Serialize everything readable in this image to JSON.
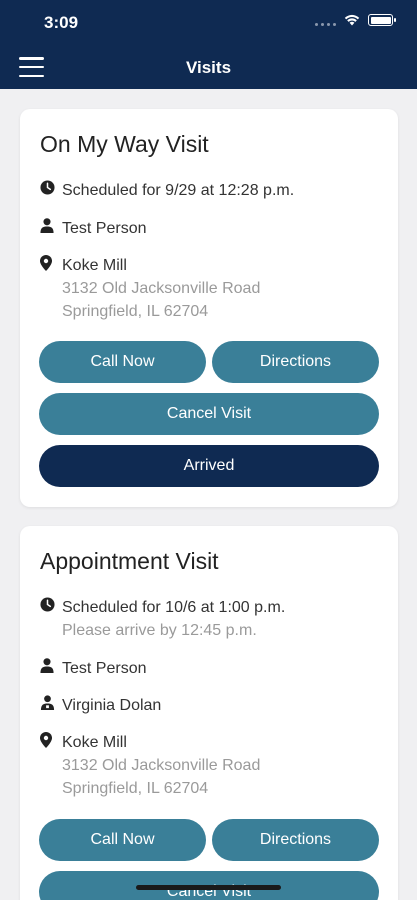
{
  "status_bar": {
    "time": "3:09"
  },
  "header": {
    "title": "Visits"
  },
  "visits": [
    {
      "title": "On My Way Visit",
      "scheduled": "Scheduled for 9/29 at 12:28 p.m.",
      "person": "Test Person",
      "location_name": "Koke Mill",
      "address_line1": "3132 Old Jacksonville Road",
      "address_line2": "Springfield, IL 62704",
      "buttons": {
        "call": "Call Now",
        "directions": "Directions",
        "cancel": "Cancel Visit",
        "arrived": "Arrived"
      }
    },
    {
      "title": "Appointment Visit",
      "scheduled": "Scheduled for 10/6 at 1:00 p.m.",
      "arrive_by": "Please arrive by 12:45 p.m.",
      "person": "Test Person",
      "provider": "Virginia Dolan",
      "location_name": "Koke Mill",
      "address_line1": "3132 Old Jacksonville Road",
      "address_line2": "Springfield, IL 62704",
      "buttons": {
        "call": "Call Now",
        "directions": "Directions",
        "cancel": "Cancel Visit"
      }
    }
  ],
  "colors": {
    "header": "#0f2a52",
    "button": "#3a7f98",
    "button_dark": "#0f2a52"
  },
  "icons": [
    "menu-icon",
    "wifi-icon",
    "battery-icon",
    "clock-icon",
    "person-icon",
    "provider-icon",
    "location-pin-icon"
  ]
}
